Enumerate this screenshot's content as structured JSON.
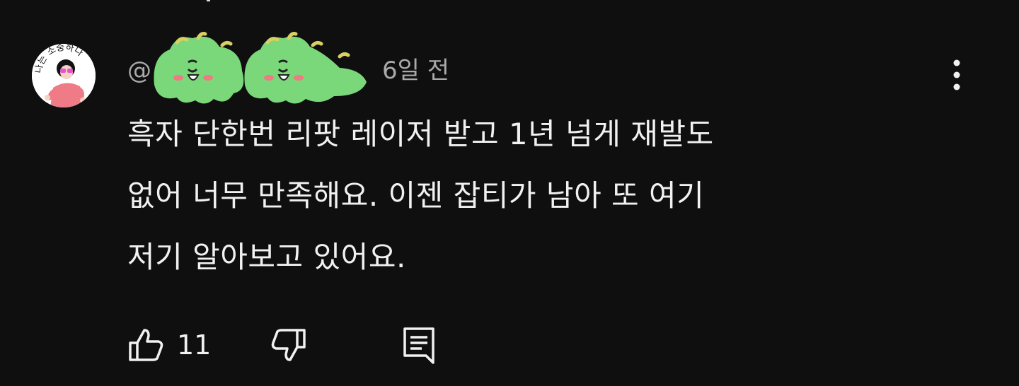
{
  "comment": {
    "author_handle_prefix": "@",
    "time_ago": "6일 전",
    "text_lines": [
      "흑자 단한번 리팟 레이저 받고 1년 넘게 재발도",
      "없어 너무 만족해요. 이젠 잡티가 남아 또 여기",
      "저기 알아보고 있어요."
    ],
    "like_count": "11"
  },
  "avatar": {
    "caption": "나는 소중하다"
  },
  "icons": {
    "more": "more-vertical-icon",
    "like": "thumb-up-icon",
    "dislike": "thumb-down-icon",
    "reply": "reply-comment-icon"
  },
  "colors": {
    "background": "#0f0f0f",
    "text_primary": "#f1f1f1",
    "text_secondary": "#aaaaaa",
    "sticker_green": "#7ad77a",
    "sticker_yellow": "#d8d060",
    "avatar_pink": "#ee7b86"
  }
}
